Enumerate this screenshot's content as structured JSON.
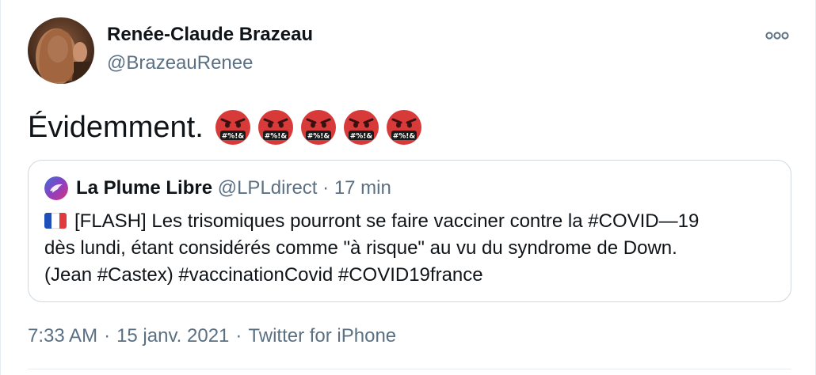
{
  "author": {
    "display_name": "Renée-Claude Brazeau",
    "handle": "@BrazeauRenee"
  },
  "more_icon": "more-horizontal-icon",
  "tweet": {
    "text": "Évidemment.",
    "emoji_count": 5,
    "emoji_name": "face-with-symbols-on-mouth",
    "emoji_symbols": "#%!&"
  },
  "quoted_tweet": {
    "display_name": "La Plume Libre",
    "handle": "@LPLdirect",
    "separator": " · ",
    "time": "17 min",
    "flag": "france-flag",
    "text_line1": "[FLASH] Les trisomiques pourront se faire vacciner contre la #COVID—19",
    "text_line2": "dès lundi, étant considérés comme \"à risque\" au vu du syndrome de Down.",
    "text_line3": "(Jean #Castex) #vaccinationCovid #COVID19france"
  },
  "meta": {
    "time": "7:33 AM",
    "date": "15 janv. 2021",
    "source": "Twitter for iPhone",
    "separator": "·"
  },
  "colors": {
    "text": "#0f1419",
    "secondary": "#5b7083",
    "border": "#cfd9de",
    "emoji_red": "#d83a3a"
  }
}
